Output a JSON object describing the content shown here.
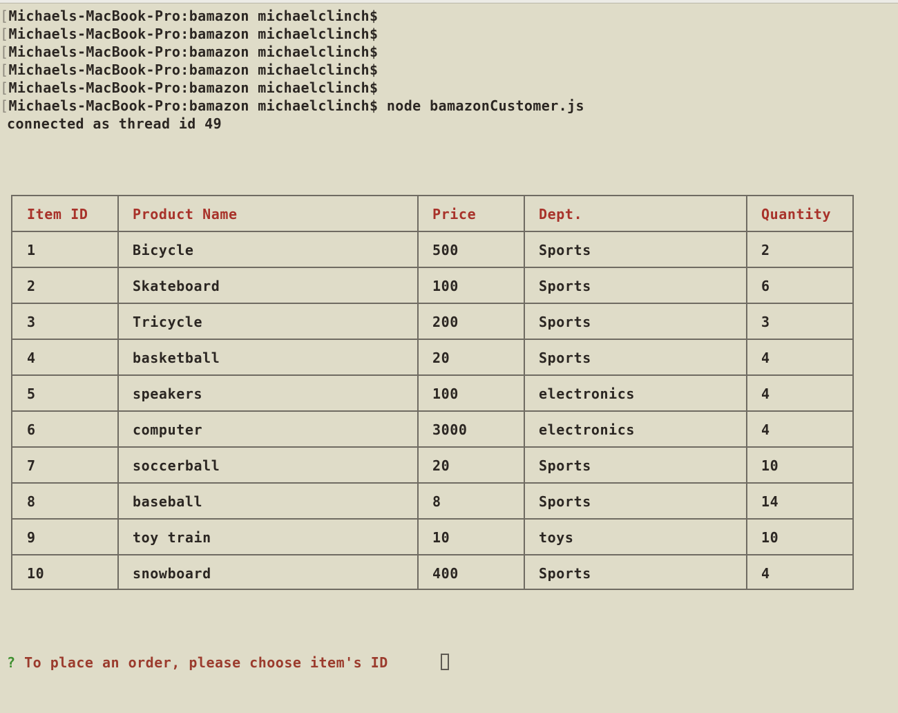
{
  "terminal": {
    "prompt_lines": [
      {
        "bracket": "[",
        "text": "Michaels-MacBook-Pro:bamazon michaelclinch$"
      },
      {
        "bracket": "[",
        "text": "Michaels-MacBook-Pro:bamazon michaelclinch$"
      },
      {
        "bracket": "[",
        "text": "Michaels-MacBook-Pro:bamazon michaelclinch$"
      },
      {
        "bracket": "[",
        "text": "Michaels-MacBook-Pro:bamazon michaelclinch$"
      },
      {
        "bracket": "[",
        "text": "Michaels-MacBook-Pro:bamazon michaelclinch$"
      },
      {
        "bracket": "[",
        "text": "Michaels-MacBook-Pro:bamazon michaelclinch$ node bamazonCustomer.js"
      }
    ],
    "connection_message": "connected as thread id 49"
  },
  "table": {
    "headers": [
      "Item ID",
      "Product Name",
      "Price",
      "Dept.",
      "Quantity"
    ],
    "rows": [
      [
        "1",
        "Bicycle",
        "500",
        "Sports",
        "2"
      ],
      [
        "2",
        "Skateboard",
        "100",
        "Sports",
        "6"
      ],
      [
        "3",
        "Tricycle",
        "200",
        "Sports",
        "3"
      ],
      [
        "4",
        "basketball",
        "20",
        "Sports",
        "4"
      ],
      [
        "5",
        "speakers",
        "100",
        "electronics",
        "4"
      ],
      [
        "6",
        "computer",
        "3000",
        "electronics",
        "4"
      ],
      [
        "7",
        "soccerball",
        "20",
        "Sports",
        "10"
      ],
      [
        "8",
        "baseball",
        "8",
        "Sports",
        "14"
      ],
      [
        "9",
        "toy train",
        "10",
        "toys",
        "10"
      ],
      [
        "10",
        "snowboard",
        "400",
        "Sports",
        "4"
      ]
    ]
  },
  "prompt": {
    "marker": "?",
    "question": "To place an order, please choose item's ID",
    "input_value": ""
  },
  "colors": {
    "background": "#dfdcc8",
    "text": "#2b2622",
    "header_text": "#a8322a",
    "prompt_marker": "#3d8f2e",
    "prompt_text": "#9b3b2d",
    "border": "#6f6b62"
  }
}
